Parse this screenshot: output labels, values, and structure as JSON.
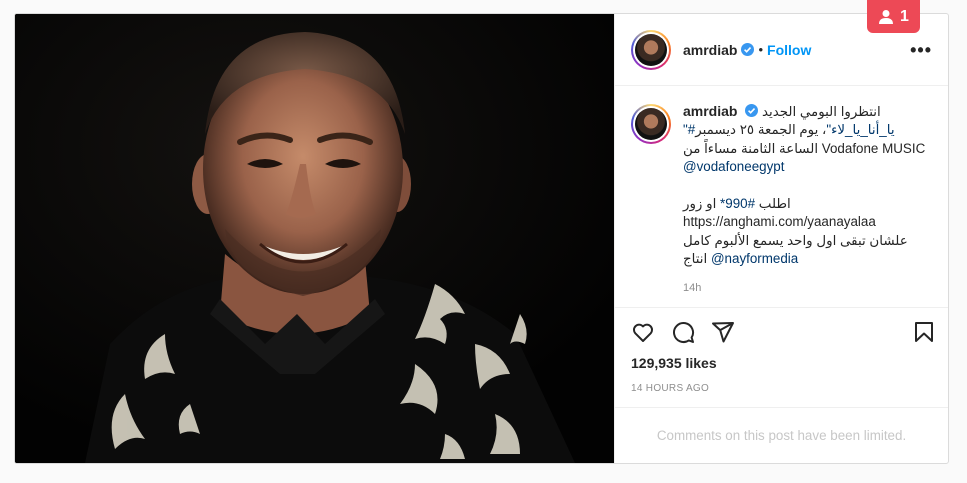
{
  "notification": {
    "count": "1",
    "icon": "person-icon"
  },
  "post": {
    "username": "amrdiab",
    "verified": true,
    "follow_label": "Follow",
    "separator": "•",
    "more_label": "•••",
    "caption": {
      "username": "amrdiab",
      "line1": "انتظروا البومي الجديد",
      "hashtag": "\"#يا_أنا_يا_لاء\"",
      "line2": "، يوم الجمعة ٢٥ ديسمبر",
      "line3": "الساعة الثامنة مساءاً من Vodafone MUSIC",
      "mention1": "@vodafoneegypt",
      "line4_prefix": "اطلب",
      "code": "#990*",
      "line4_suffix": "او زور",
      "link": "https://anghami.com/yaanayalaa",
      "line5": "علشان تبقى اول واحد يسمع الألبوم كامل",
      "line6_prefix": "انتاج",
      "mention2": "@nayformedia",
      "time": "14h"
    },
    "likes": "129,935 likes",
    "posted_ago": "14 HOURS AGO",
    "comments_limited": "Comments on this post have been limited."
  },
  "icons": {
    "like": "heart-icon",
    "comment": "comment-icon",
    "share": "share-icon",
    "save": "bookmark-icon",
    "verified": "verified-badge-icon"
  },
  "colors": {
    "accent": "#0095f6",
    "notification": "#ed4956",
    "verified": "#3897f0"
  }
}
